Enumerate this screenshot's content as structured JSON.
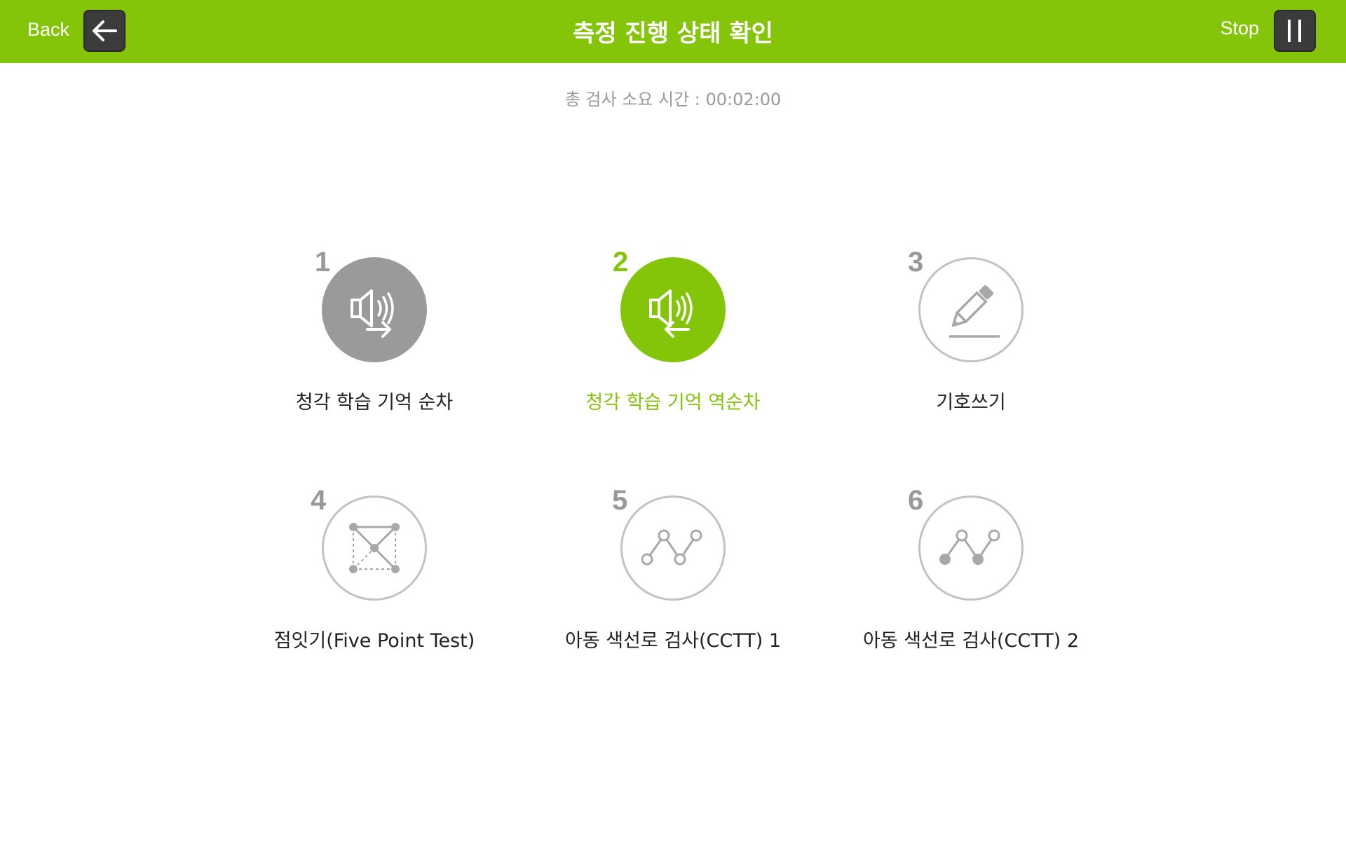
{
  "header": {
    "back_label": "Back",
    "title": "측정 진행 상태 확인",
    "stop_label": "Stop",
    "color": "#84c50a"
  },
  "timer": {
    "text": "총 검사 소요 시간 : 00:02:00"
  },
  "items": [
    {
      "num": "1",
      "label": "청각 학습 기억 순차",
      "state": "done",
      "icon": "speaker-forward-icon"
    },
    {
      "num": "2",
      "label": "청각 학습 기억 역순차",
      "state": "active",
      "icon": "speaker-backward-icon"
    },
    {
      "num": "3",
      "label": "기호쓰기",
      "state": "pending",
      "icon": "pencil-icon"
    },
    {
      "num": "4",
      "label": "점잇기(Five Point Test)",
      "state": "pending",
      "icon": "five-point-icon"
    },
    {
      "num": "5",
      "label": "아동 색선로 검사(CCTT) 1",
      "state": "pending",
      "icon": "trail-open-icon"
    },
    {
      "num": "6",
      "label": "아동 색선로 검사(CCTT) 2",
      "state": "pending",
      "icon": "trail-mixed-icon"
    }
  ],
  "colors": {
    "active": "#84c50a",
    "done": "#9a9a9a",
    "pending_border": "#c2c2c2"
  }
}
